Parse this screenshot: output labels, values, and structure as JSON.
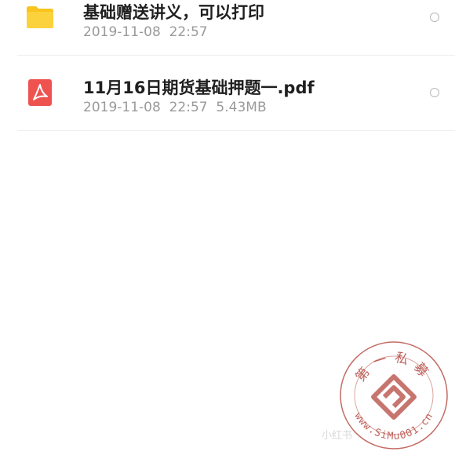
{
  "files": [
    {
      "name": "基础赠送讲义，可以打印",
      "date": "2019-11-08",
      "time": "22:57",
      "size": "",
      "icon": "folder-icon"
    },
    {
      "name": "11月16日期货基础押题一.pdf",
      "date": "2019-11-08",
      "time": "22:57",
      "size": "5.43MB",
      "icon": "pdf-icon"
    }
  ],
  "watermark": {
    "top_text": "第一私募",
    "url_text": "www.SiMu001.cn",
    "caption": "小红书",
    "color": "#b5473f"
  },
  "colors": {
    "folder": "#f9c41c",
    "pdf": "#ee5350",
    "divider": "#efefef"
  }
}
